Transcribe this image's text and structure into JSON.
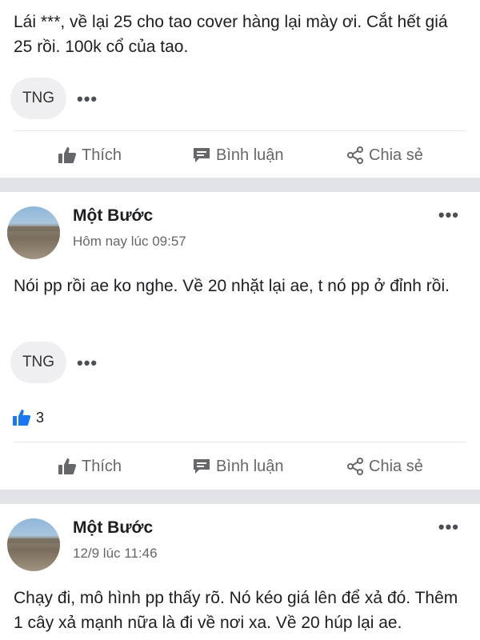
{
  "posts": [
    {
      "text": "Lái ***, về lại 25 cho tao cover hàng lại mày ơi. Cắt hết giá 25 rồi. 100k cổ của tao.",
      "chip": "TNG",
      "more": "•••"
    },
    {
      "author": "Một Bước",
      "time": "Hôm nay lúc 09:57",
      "text": "Nói pp rồi ae ko nghe. Về 20 nhặt lại ae, t nó pp ở đỉnh rồi.",
      "chip": "TNG",
      "more": "•••",
      "likes": "3"
    },
    {
      "author": "Một Bước",
      "time": "12/9 lúc 11:46",
      "text": "Chạy đi, mô hình pp thấy rõ. Nó kéo giá lên để xả đó. Thêm 1 cây xả mạnh nữa là đi về nơi xa. Về 20 húp lại ae.",
      "more": "•••"
    }
  ],
  "actions": {
    "like": "Thích",
    "comment": "Bình luận",
    "share": "Chia sẻ"
  },
  "colors": {
    "like_blue": "#1877f2",
    "separator": "#e1e3e6",
    "chip_bg": "#efeff1"
  },
  "icons": [
    "thumbs-up-icon",
    "comment-icon",
    "share-icon",
    "more-icon"
  ]
}
